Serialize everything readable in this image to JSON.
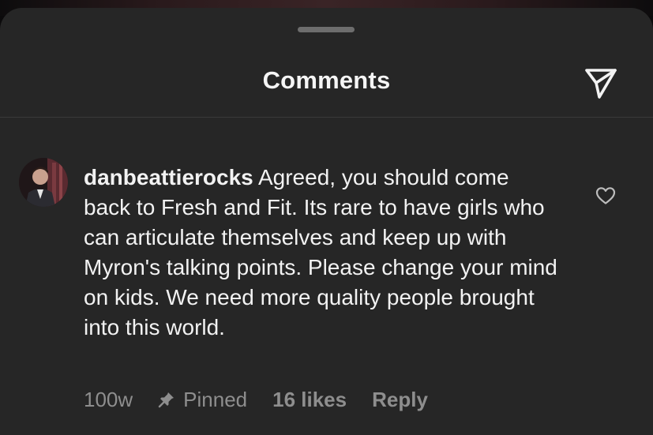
{
  "header": {
    "title": "Comments",
    "share_icon": "send-icon"
  },
  "comment": {
    "username": "danbeattierocks",
    "text": "Agreed, you should come back to Fresh and Fit. Its rare to have girls who can articulate themselves and keep up with Myron's talking points. Please change your mind on kids. We need more quality people brought into this world.",
    "age": "100w",
    "pinned_label": "Pinned",
    "likes": "16 likes",
    "reply_label": "Reply",
    "like_icon": "heart-outline-icon",
    "pin_icon": "pin-icon"
  },
  "colors": {
    "sheet_background": "#262626",
    "primary_text": "#f2f2f2",
    "secondary_text": "#8e8e8e"
  }
}
